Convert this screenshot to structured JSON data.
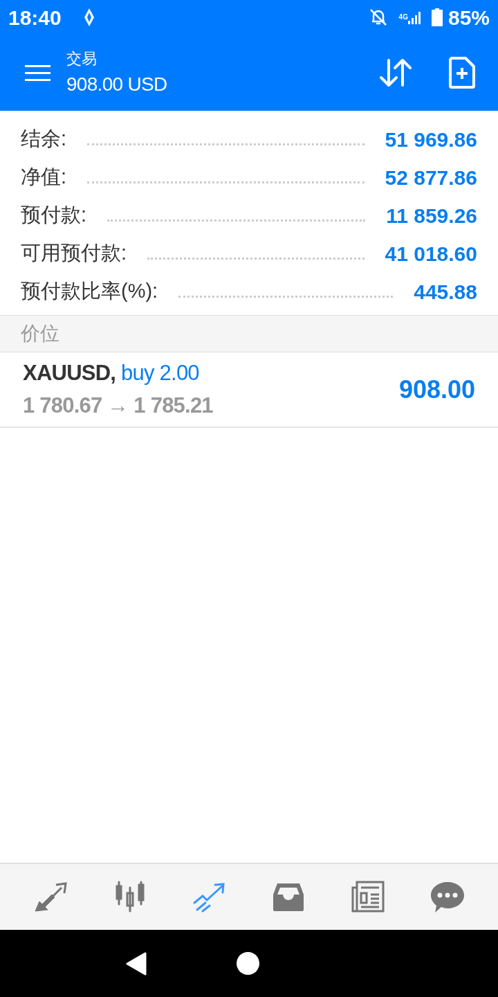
{
  "status_bar": {
    "time": "18:40",
    "battery": "85%",
    "network": "4G"
  },
  "app_bar": {
    "title": "交易",
    "subtitle": "908.00 USD"
  },
  "summary": [
    {
      "label": "结余:",
      "value": "51 969.86"
    },
    {
      "label": "净值:",
      "value": "52 877.86"
    },
    {
      "label": "预付款:",
      "value": "11 859.26"
    },
    {
      "label": "可用预付款:",
      "value": "41 018.60"
    },
    {
      "label": "预付款比率(%):",
      "value": "445.88"
    }
  ],
  "section": {
    "title": "价位"
  },
  "positions": [
    {
      "symbol": "XAUUSD,",
      "side": "buy 2.00",
      "prices": "1 780.67 → 1 785.21",
      "profit": "908.00"
    }
  ],
  "bottom_nav": [
    {
      "kind": "quotes",
      "selected": false
    },
    {
      "kind": "chart",
      "selected": false
    },
    {
      "kind": "trade",
      "selected": true
    },
    {
      "kind": "history",
      "selected": false
    },
    {
      "kind": "news",
      "selected": false
    },
    {
      "kind": "chat",
      "selected": false
    }
  ]
}
